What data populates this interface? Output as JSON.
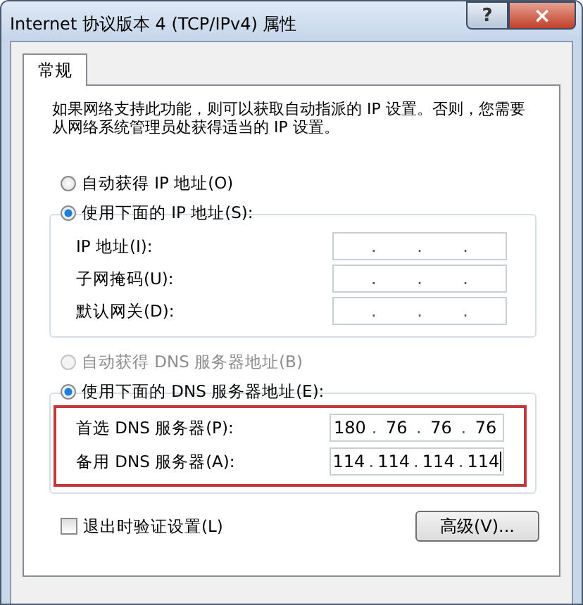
{
  "window": {
    "title": "Internet 协议版本 4 (TCP/IPv4) 属性",
    "help_button": "?",
    "close_button": "×"
  },
  "tabs": [
    {
      "label": "常规",
      "selected": true
    }
  ],
  "description": "如果网络支持此功能，则可以获取自动指派的 IP 设置。否则，您需要从网络系统管理员处获得适当的 IP 设置。",
  "ip_options": [
    {
      "label": "自动获得 IP 地址(O)",
      "selected": false,
      "disabled": false
    },
    {
      "label": "使用下面的 IP 地址(S):",
      "selected": true,
      "disabled": false
    }
  ],
  "ip_fields": [
    {
      "label": "IP 地址(I):",
      "separators": [
        ".",
        ".",
        "."
      ]
    },
    {
      "label": "子网掩码(U):",
      "separators": [
        ".",
        ".",
        "."
      ]
    },
    {
      "label": "默认网关(D):",
      "separators": [
        ".",
        ".",
        "."
      ]
    }
  ],
  "dns_options": [
    {
      "label": "自动获得 DNS 服务器地址(B)",
      "selected": false,
      "disabled": true
    },
    {
      "label": "使用下面的 DNS 服务器地址(E):",
      "selected": true,
      "disabled": false
    }
  ],
  "dns_highlighted": true,
  "dns_fields": [
    {
      "label": "首选 DNS 服务器(P):",
      "octets": [
        "180",
        "76",
        "76",
        "76"
      ],
      "separators": [
        ".",
        ".",
        "."
      ],
      "focused": false
    },
    {
      "label": "备用 DNS 服务器(A):",
      "octets": [
        "114",
        "114",
        "114",
        "114"
      ],
      "separators": [
        ".",
        ".",
        "."
      ],
      "focused": true
    }
  ],
  "validate_on_exit": {
    "label": "退出时验证设置(L)",
    "checked": false
  },
  "advanced_button": "高级(V)..."
}
